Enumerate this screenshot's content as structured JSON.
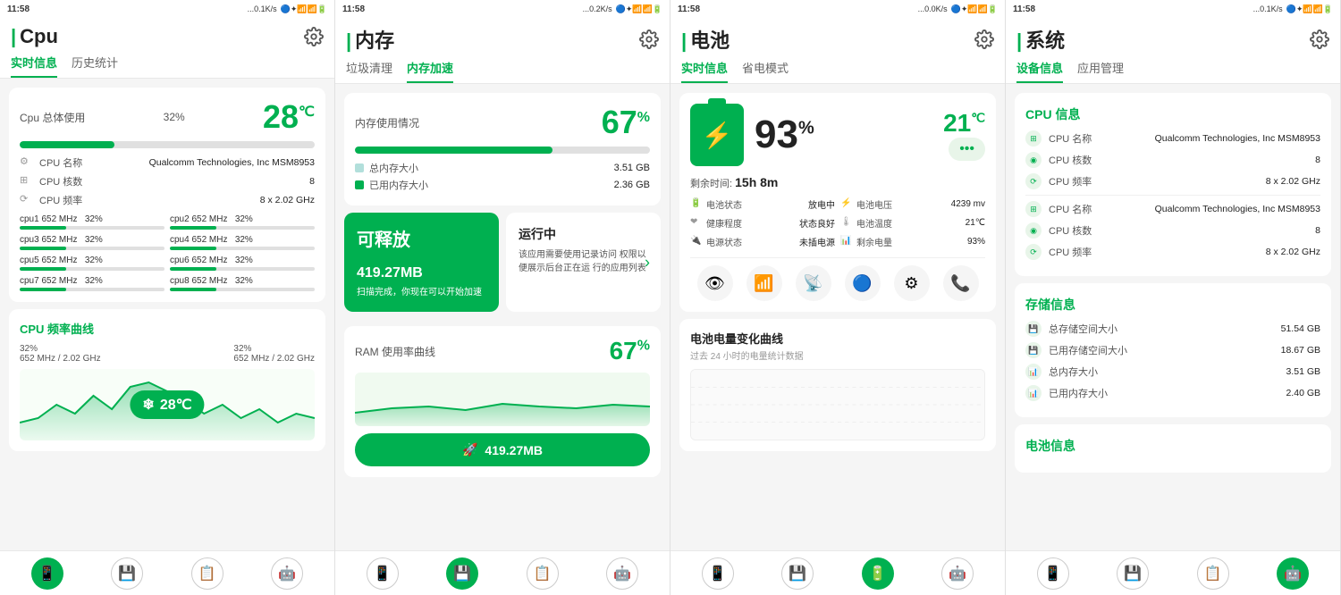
{
  "panels": [
    {
      "id": "cpu",
      "status_time": "11:58",
      "status_signal": "...0.1K/s",
      "header_title": "Cpu",
      "tabs": [
        "实时信息",
        "历史统计"
      ],
      "active_tab": 0,
      "cpu_usage_label": "Cpu 总体使用",
      "cpu_usage_pct": "32%",
      "cpu_temp": "28",
      "cpu_temp_unit": "℃",
      "progress_pct": 32,
      "cpu_name_label": "CPU 名称",
      "cpu_name_value": "Qualcomm Technologies, Inc MSM8953",
      "cpu_cores_label": "CPU 核数",
      "cpu_cores_value": "8",
      "cpu_freq_label": "CPU 频率",
      "cpu_freq_value": "8 x 2.02 GHz",
      "cores": [
        {
          "name": "cpu1",
          "freq": "652 MHz",
          "pct": "32%",
          "fill": 32
        },
        {
          "name": "cpu2",
          "freq": "652 MHz",
          "pct": "32%",
          "fill": 32
        },
        {
          "name": "cpu3",
          "freq": "652 MHz",
          "pct": "32%",
          "fill": 32
        },
        {
          "name": "cpu4",
          "freq": "652 MHz",
          "pct": "32%",
          "fill": 32
        },
        {
          "name": "cpu5",
          "freq": "652 MHz",
          "pct": "32%",
          "fill": 32
        },
        {
          "name": "cpu6",
          "freq": "652 MHz",
          "pct": "32%",
          "fill": 32
        },
        {
          "name": "cpu7",
          "freq": "652 MHz",
          "pct": "32%",
          "fill": 32
        },
        {
          "name": "cpu8",
          "freq": "652 MHz",
          "pct": "32%",
          "fill": 32
        }
      ],
      "freq_section_title": "CPU 频率曲线",
      "freq_left_label": "32%",
      "freq_left_sub": "652 MHz / 2.02 GHz",
      "freq_right_label": "32%",
      "freq_right_sub": "652 MHz / 2.02 GHz",
      "temp_badge": "28℃"
    },
    {
      "id": "memory",
      "status_time": "11:58",
      "status_signal": "...0.2K/s",
      "header_title": "内存",
      "tabs": [
        "垃圾清理",
        "内存加速"
      ],
      "active_tab": 1,
      "mem_usage_label": "内存使用情况",
      "mem_usage_pct": "67",
      "mem_progress": 67,
      "total_mem_label": "总内存大小",
      "total_mem_value": "3.51 GB",
      "used_mem_label": "已用内存大小",
      "used_mem_value": "2.36 GB",
      "release_title": "可释放",
      "release_mb": "419.27",
      "release_mb_unit": "MB",
      "release_desc": "扫描完成，你现在可以开始\n加速",
      "running_title": "运行中",
      "running_desc": "该应用需要使用记录访问\n权限以便展示后台正在运\n行的应用列表",
      "ram_chart_title": "RAM 使用率曲线",
      "ram_chart_pct": "67",
      "boost_mb": "419.27",
      "boost_mb_unit": "MB"
    },
    {
      "id": "battery",
      "status_time": "11:58",
      "status_signal": "...0.0K/s",
      "header_title": "电池",
      "tabs": [
        "实时信息",
        "省电模式"
      ],
      "active_tab": 0,
      "battery_pct": "93",
      "battery_temp": "21",
      "battery_temp_unit": "℃",
      "remaining_label": "剩余时间:",
      "remaining_value": "15h 8m",
      "batt_status_label": "电池状态",
      "batt_status_value": "放电中",
      "batt_health_label": "健康程度",
      "batt_health_value": "状态良好",
      "batt_power_label": "电源状态",
      "batt_power_value": "未插电源",
      "batt_voltage_label": "电池电压",
      "batt_voltage_value": "4239 mv",
      "batt_temp2_label": "电池温度",
      "batt_temp2_value": "21℃",
      "batt_remain_label": "剩余电量",
      "batt_remain_value": "93%",
      "batt_chart_title": "电池电量变化曲线",
      "batt_chart_sub": "过去 24 小时的电量统计数据"
    },
    {
      "id": "system",
      "status_time": "11:58",
      "status_signal": "...0.1K/s",
      "header_title": "系统",
      "tabs": [
        "设备信息",
        "应用管理"
      ],
      "active_tab": 0,
      "cpu_section_title": "CPU 信息",
      "sys_cpu_rows": [
        {
          "label": "CPU 名称",
          "value": "Qualcomm Technologies, Inc MSM8953"
        },
        {
          "label": "CPU 核数",
          "value": "8"
        },
        {
          "label": "CPU 频率",
          "value": "8 x 2.02 GHz"
        },
        {
          "label": "CPU 名称",
          "value": "Qualcomm Technologies, Inc MSM8953"
        },
        {
          "label": "CPU 核数",
          "value": "8"
        },
        {
          "label": "CPU 频率",
          "value": "8 x 2.02 GHz"
        }
      ],
      "storage_section_title": "存储信息",
      "storage_rows": [
        {
          "label": "总存储空间大小",
          "value": "51.54 GB"
        },
        {
          "label": "已用存储空间大小",
          "value": "18.67 GB"
        },
        {
          "label": "总内存大小",
          "value": "3.51 GB"
        },
        {
          "label": "已用内存大小",
          "value": "2.40 GB"
        }
      ],
      "battery_section_title": "电池信息"
    }
  ],
  "nav_icons": [
    "📱",
    "💾",
    "📋",
    "🤖"
  ],
  "colors": {
    "green": "#00b050",
    "light_green_bg": "#e8f5e9",
    "text_dark": "#222222",
    "text_mid": "#555555",
    "text_light": "#999999"
  }
}
